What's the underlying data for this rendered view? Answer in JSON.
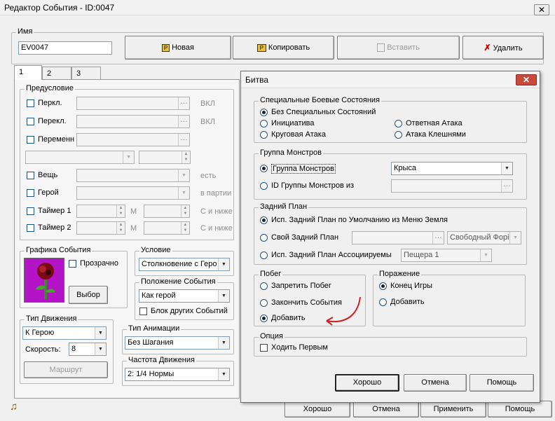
{
  "main": {
    "title": "Редактор События - ID:0047",
    "name_label": "Имя",
    "name_value": "EV0047",
    "buttons": {
      "new": "Новая",
      "copy": "Копировать",
      "paste": "Вставить",
      "delete": "Удалить"
    },
    "tabs": [
      "1",
      "2",
      "3"
    ],
    "conditions": {
      "group_label": "Предусловие",
      "switch1": "Перкл.",
      "switch1_state": "ВКЛ",
      "switch2": "Перекл.",
      "switch2_state": "ВКЛ",
      "variable": "Переменн",
      "item": "Вещь",
      "item_state": "есть",
      "hero": "Герой",
      "hero_state": "в партии",
      "timer1": "Таймер 1",
      "timer1_unit": "М",
      "timer1_cond": "С и ниже",
      "timer2": "Таймер 2",
      "timer2_unit": "М",
      "timer2_cond": "С и ниже"
    },
    "graphics": {
      "label": "Графика События",
      "transparent": "Прозрачно",
      "choose": "Выбор"
    },
    "trigger": {
      "label": "Условие",
      "value": "Столкновение с Геро"
    },
    "position": {
      "label": "Положение События",
      "value": "Как герой",
      "block": "Блок других Событий"
    },
    "movement": {
      "label": "Тип Движения",
      "value": "К Герою",
      "speed_label": "Скорость:",
      "speed": "8",
      "route": "Маршрут"
    },
    "animation": {
      "label": "Тип Анимации",
      "value": "Без Шагания"
    },
    "frequency": {
      "label": "Частота Движения",
      "value": "2: 1/4 Нормы"
    },
    "footer": {
      "ok": "Хорошо",
      "cancel": "Отмена",
      "apply": "Применить",
      "help": "Помощь"
    }
  },
  "dialog": {
    "title": "Битва",
    "special": {
      "label": "Специальные Боевые Состояния",
      "none": "Без Специальных Состояний",
      "initiative": "Инициатива",
      "counter": "Ответная Атака",
      "surround": "Круговая Атака",
      "pincer": "Атака Клешнями"
    },
    "monsters": {
      "label": "Группа Монстров",
      "group": "Группа Монстров",
      "group_value": "Крыса",
      "id_group": "ID Группы Монстров из"
    },
    "background": {
      "label": "Задний План",
      "default": "Исп. Задний План по Умолчанию из Меню Земля",
      "own": "Свой Задний План",
      "own_format": "Свободный Форі",
      "assoc": "Исп. Задний План Ассоциируемы",
      "assoc_value": "Пещера 1"
    },
    "escape": {
      "label": "Побег",
      "forbid": "Запретить Побег",
      "end": "Закончить События",
      "add": "Добавить"
    },
    "defeat": {
      "label": "Поражение",
      "game_over": "Конец Игры",
      "add": "Добавить"
    },
    "option": {
      "label": "Опция",
      "first_strike": "Ходить Первым"
    },
    "buttons": {
      "ok": "Хорошо",
      "cancel": "Отмена",
      "help": "Помощь"
    },
    "annotation_color": "#cc1f1f"
  }
}
